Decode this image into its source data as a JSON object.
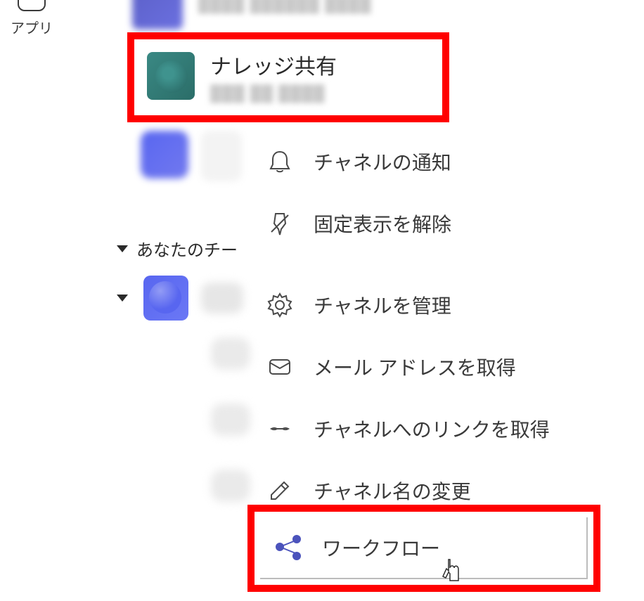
{
  "sidebar": {
    "apps_label": "アプリ"
  },
  "teams_rows": [
    {
      "title": "",
      "subtitle": ""
    },
    {
      "title": "ナレッジ共有",
      "subtitle": ""
    }
  ],
  "section_header": "あなたのチー",
  "context_menu": [
    {
      "id": "notifications",
      "label": "チャネルの通知"
    },
    {
      "id": "unpin",
      "label": "固定表示を解除"
    },
    {
      "id": "manage",
      "label": "チャネルを管理"
    },
    {
      "id": "getemail",
      "label": "メール アドレスを取得"
    },
    {
      "id": "getlink",
      "label": "チャネルへのリンクを取得"
    },
    {
      "id": "rename",
      "label": "チャネル名の変更"
    },
    {
      "id": "workflow",
      "label": "ワークフロー"
    }
  ]
}
